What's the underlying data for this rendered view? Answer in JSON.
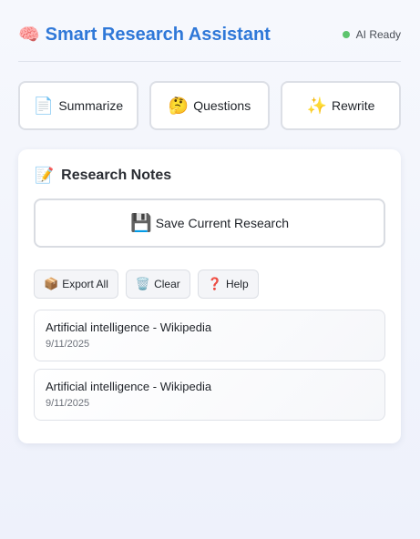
{
  "header": {
    "icon": "🧠",
    "title": "Smart Research Assistant",
    "status_text": "AI Ready",
    "status_color": "#5dc46d",
    "accent_color": "#2f78d8"
  },
  "actions": [
    {
      "icon": "📄",
      "label": "Summarize"
    },
    {
      "icon": "🤔",
      "label": "Questions"
    },
    {
      "icon": "✨",
      "label": "Rewrite"
    }
  ],
  "notes_panel": {
    "icon": "📝",
    "title": "Research Notes",
    "save_icon": "💾",
    "save_label": "Save Current Research",
    "tools": [
      {
        "icon": "📦",
        "label": "Export All"
      },
      {
        "icon": "🗑️",
        "label": "Clear"
      },
      {
        "icon": "❓",
        "label": "Help"
      }
    ],
    "notes": [
      {
        "title": "Artificial intelligence - Wikipedia",
        "date": "9/11/2025"
      },
      {
        "title": "Artificial intelligence - Wikipedia",
        "date": "9/11/2025"
      }
    ]
  }
}
